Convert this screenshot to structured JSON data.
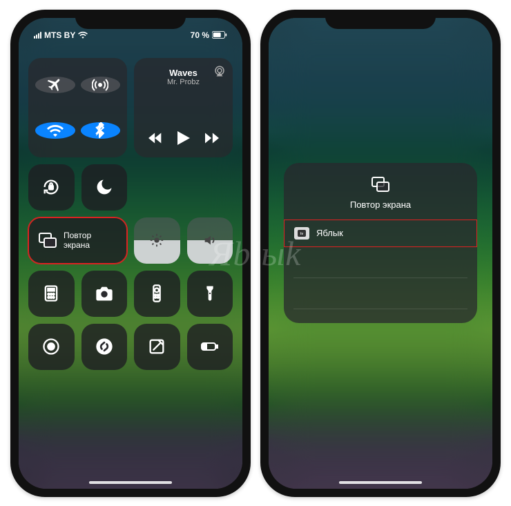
{
  "status": {
    "carrier": "MTS BY",
    "battery_pct": "70 %"
  },
  "control_center": {
    "media": {
      "title": "Waves",
      "artist": "Mr. Probz"
    },
    "screen_mirror_line1": "Повтор",
    "screen_mirror_line2": "экрана",
    "icons": {
      "airplane": "airplane-icon",
      "airdrop": "airdrop-icon",
      "wifi": "wifi-icon",
      "bluetooth": "bluetooth-icon",
      "orientation_lock": "orientation-lock-icon",
      "dnd": "moon-icon",
      "brightness": "brightness-icon",
      "volume": "volume-icon",
      "calculator": "calculator-icon",
      "camera": "camera-icon",
      "remote": "apple-tv-remote-icon",
      "flashlight": "flashlight-icon",
      "screen_record": "screen-record-icon",
      "shazam": "shazam-icon",
      "notes": "notes-icon",
      "low_power": "low-power-icon"
    }
  },
  "mirror_panel": {
    "title": "Повтор экрана",
    "device_name": "Яблык"
  },
  "watermark": "Яblыk",
  "colors": {
    "highlight": "#d22",
    "blue_active": "#0a84ff"
  }
}
